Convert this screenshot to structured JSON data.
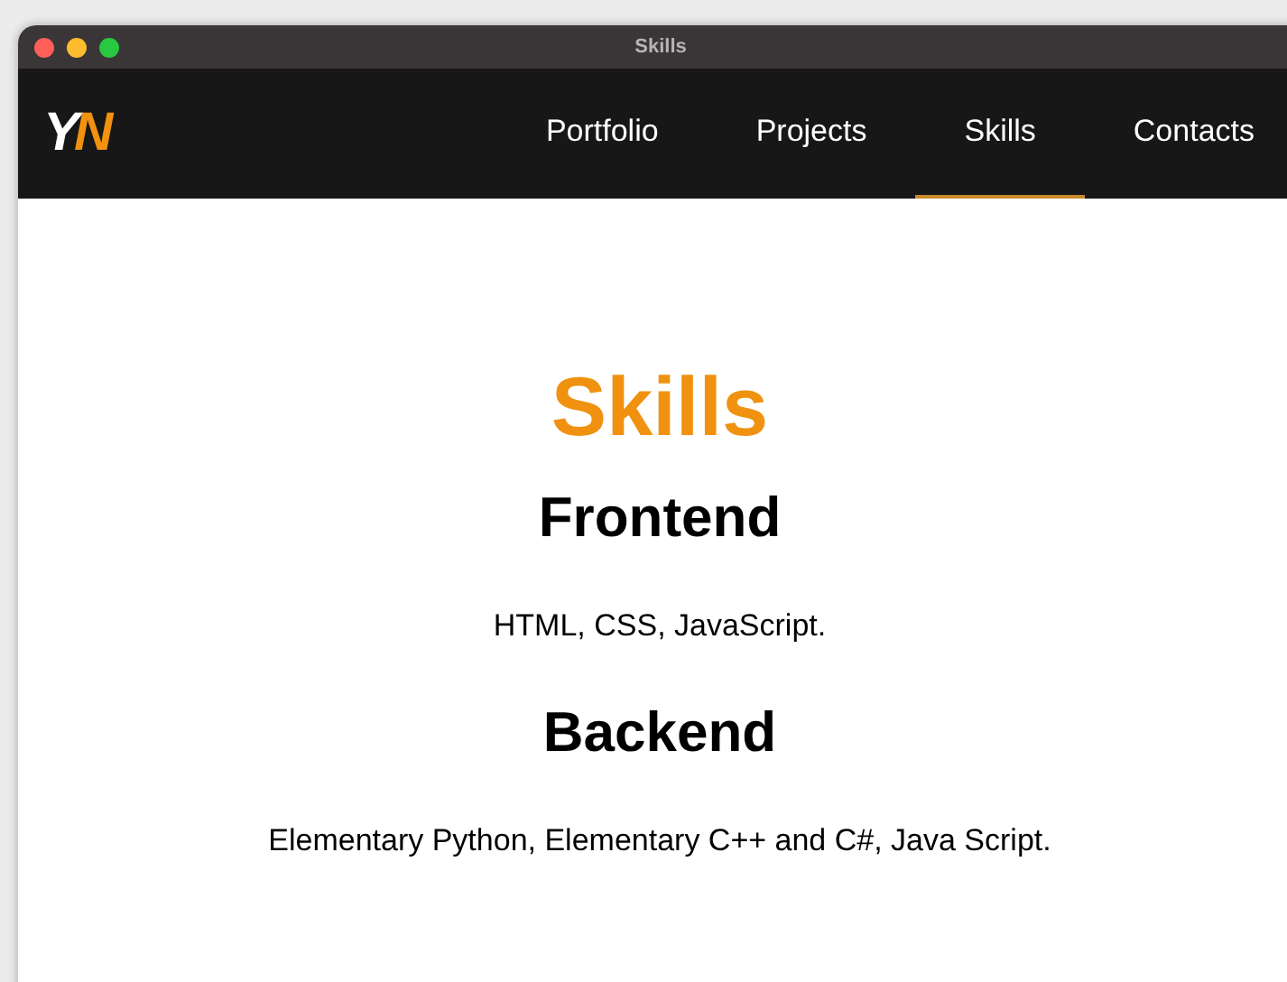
{
  "window": {
    "title": "Skills"
  },
  "logo": [
    {
      "text": "Y",
      "color": "#ffffff"
    },
    {
      "text": "N",
      "color": "#f0920f"
    }
  ],
  "nav": [
    {
      "label": "Portfolio",
      "selected": false
    },
    {
      "label": "Projects",
      "selected": false
    },
    {
      "label": "Skills",
      "selected": true
    },
    {
      "label": "Contacts",
      "selected": false
    }
  ],
  "page": {
    "title": "Skills",
    "sections": [
      {
        "heading": "Frontend",
        "text": "HTML, CSS, JavaScript."
      },
      {
        "heading": "Backend",
        "text": "Elementary Python, Elementary C++ and C#, Java Script."
      }
    ]
  }
}
